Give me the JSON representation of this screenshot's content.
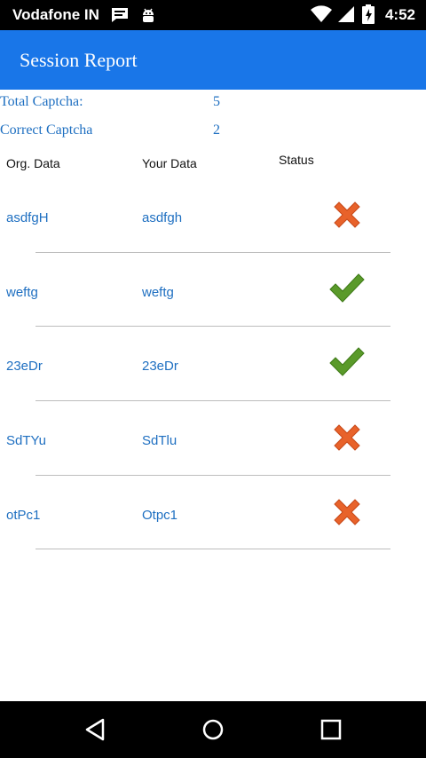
{
  "status_bar": {
    "carrier": "Vodafone IN",
    "time": "4:52",
    "icons": [
      "message-icon",
      "android-debug-icon",
      "wifi-icon",
      "signal-icon",
      "battery-charging-icon"
    ]
  },
  "app_bar": {
    "title": "Session Report"
  },
  "summary": {
    "total_label": "Total Captcha:",
    "total_value": "5",
    "correct_label": "Correct Captcha",
    "correct_value": "2"
  },
  "table": {
    "headers": {
      "original": "Org. Data",
      "yours": "Your Data",
      "status": "Status"
    },
    "rows": [
      {
        "original": "asdfgH",
        "yours": "asdfgh",
        "status": "incorrect"
      },
      {
        "original": "weftg",
        "yours": "weftg",
        "status": "correct"
      },
      {
        "original": "23eDr",
        "yours": "23eDr",
        "status": "correct"
      },
      {
        "original": "SdTYu",
        "yours": "SdTlu",
        "status": "incorrect"
      },
      {
        "original": "otPc1",
        "yours": "Otpc1",
        "status": "incorrect"
      }
    ]
  },
  "nav_bar": {
    "icons": [
      "back-icon",
      "home-icon",
      "recents-icon"
    ]
  },
  "colors": {
    "app_bar": "#1976e8",
    "link_text": "#1e6fc1",
    "check": "#5a9a2a",
    "cross": "#e8622a"
  }
}
